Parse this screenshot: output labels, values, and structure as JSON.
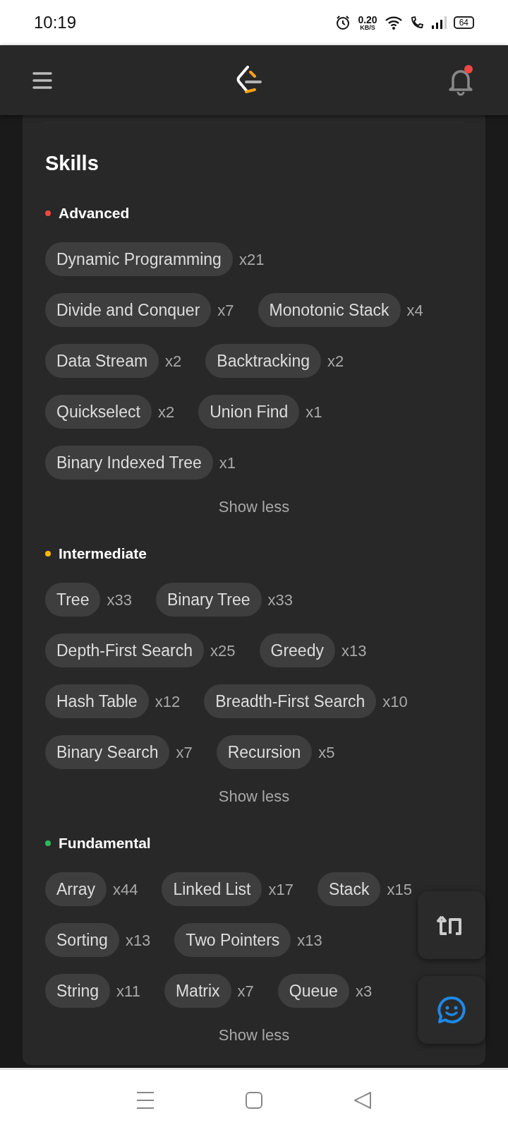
{
  "status_bar": {
    "time": "10:19",
    "net_speed": "0.20",
    "net_unit": "KB/S",
    "battery": "64"
  },
  "header": {
    "notification_dot": true
  },
  "skills": {
    "title": "Skills",
    "levels": [
      {
        "name": "Advanced",
        "color": "#ef4743",
        "toggle": "Show less",
        "tags": [
          {
            "name": "Dynamic Programming",
            "count": "x21"
          },
          {
            "name": "Divide and Conquer",
            "count": "x7"
          },
          {
            "name": "Monotonic Stack",
            "count": "x4"
          },
          {
            "name": "Data Stream",
            "count": "x2"
          },
          {
            "name": "Backtracking",
            "count": "x2"
          },
          {
            "name": "Quickselect",
            "count": "x2"
          },
          {
            "name": "Union Find",
            "count": "x1"
          },
          {
            "name": "Binary Indexed Tree",
            "count": "x1"
          }
        ]
      },
      {
        "name": "Intermediate",
        "color": "#ffb800",
        "toggle": "Show less",
        "tags": [
          {
            "name": "Tree",
            "count": "x33"
          },
          {
            "name": "Binary Tree",
            "count": "x33"
          },
          {
            "name": "Depth-First Search",
            "count": "x25"
          },
          {
            "name": "Greedy",
            "count": "x13"
          },
          {
            "name": "Hash Table",
            "count": "x12"
          },
          {
            "name": "Breadth-First Search",
            "count": "x10"
          },
          {
            "name": "Binary Search",
            "count": "x7"
          },
          {
            "name": "Recursion",
            "count": "x5"
          }
        ]
      },
      {
        "name": "Fundamental",
        "color": "#2cbb5d",
        "toggle": "Show less",
        "tags": [
          {
            "name": "Array",
            "count": "x44"
          },
          {
            "name": "Linked List",
            "count": "x17"
          },
          {
            "name": "Stack",
            "count": "x15"
          },
          {
            "name": "Sorting",
            "count": "x13"
          },
          {
            "name": "Two Pointers",
            "count": "x13"
          },
          {
            "name": "String",
            "count": "x11"
          },
          {
            "name": "Matrix",
            "count": "x7"
          },
          {
            "name": "Queue",
            "count": "x3"
          }
        ]
      }
    ]
  }
}
